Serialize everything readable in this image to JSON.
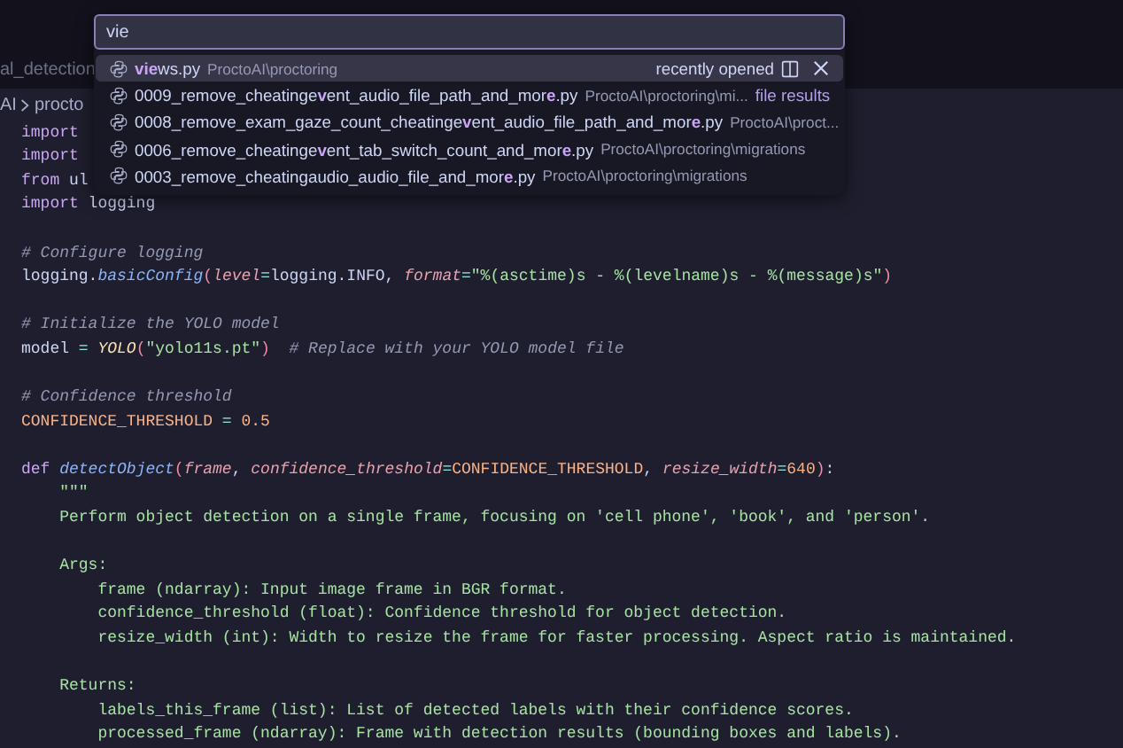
{
  "tab": {
    "label": "al_detection"
  },
  "breadcrumb": [
    "AI",
    "procto"
  ],
  "quick_open": {
    "query": "vie",
    "items": [
      {
        "name": "**vie**ws.py",
        "path": "ProctoAI\\proctoring",
        "section": "recently opened",
        "selected": true
      },
      {
        "name": "0009_remove_cheatinge**v**ent_audio_file_path_and_mor**e**.py",
        "path": "ProctoAI\\proctoring\\mi...",
        "section": "file results",
        "selected": false
      },
      {
        "name": "0008_remove_exam_gaze_count_cheatinge**v**ent_audio_file_path_and_mor**e**.py",
        "path": "ProctoAI\\proct...",
        "selected": false
      },
      {
        "name": "0006_remove_cheatinge**v**ent_tab_switch_count_and_mor**e**.py",
        "path": "ProctoAI\\proctoring\\migrations",
        "selected": false
      },
      {
        "name": "0003_remove_cheatingaudio_audio_file_and_mor**e**.py",
        "path": "ProctoAI\\proctoring\\migrations",
        "selected": false
      }
    ]
  },
  "code_blocks": [
    [
      [
        {
          "kind": "kw",
          "text": "import"
        }
      ],
      [
        {
          "kind": "kw",
          "text": "import"
        }
      ],
      [
        {
          "kind": "kw",
          "text": "from"
        },
        {
          "kind": "txt",
          "text": " ul"
        }
      ],
      [
        {
          "kind": "kw",
          "text": "import"
        },
        {
          "kind": "txt",
          "text": " logging"
        }
      ]
    ],
    [
      [
        {
          "kind": "cmt",
          "text": "# Configure logging"
        }
      ],
      [
        {
          "kind": "txt",
          "text": "logging."
        },
        {
          "kind": "fn",
          "text": "basicConfig"
        },
        {
          "kind": "par",
          "text": "("
        },
        {
          "kind": "arg",
          "text": "level"
        },
        {
          "kind": "op",
          "text": "="
        },
        {
          "kind": "txt",
          "text": "logging.INFO, "
        },
        {
          "kind": "arg",
          "text": "format"
        },
        {
          "kind": "op",
          "text": "="
        },
        {
          "kind": "str",
          "text": "\"%(asctime)s - %(levelname)s - %(message)s\""
        },
        {
          "kind": "par",
          "text": ")"
        }
      ]
    ],
    [
      [
        {
          "kind": "cmt",
          "text": "# Initialize the YOLO model"
        }
      ],
      [
        {
          "kind": "txt",
          "text": "model "
        },
        {
          "kind": "op",
          "text": "= "
        },
        {
          "kind": "cls",
          "text": "YOLO"
        },
        {
          "kind": "par",
          "text": "("
        },
        {
          "kind": "str",
          "text": "\"yolo11s.pt\""
        },
        {
          "kind": "par",
          "text": ")  "
        },
        {
          "kind": "cmt",
          "text": "# Replace with your YOLO model file"
        }
      ]
    ],
    [
      [
        {
          "kind": "cmt",
          "text": "# Confidence threshold"
        }
      ],
      [
        {
          "kind": "num",
          "text": "CONFIDENCE_THRESHOLD"
        },
        {
          "kind": "op",
          "text": " = "
        },
        {
          "kind": "num",
          "text": "0.5"
        }
      ]
    ],
    [
      [
        {
          "kind": "kw",
          "text": "def "
        },
        {
          "kind": "fn",
          "text": "detectObject"
        },
        {
          "kind": "par",
          "text": "("
        },
        {
          "kind": "arg",
          "text": "frame"
        },
        {
          "kind": "txt",
          "text": ", "
        },
        {
          "kind": "arg",
          "text": "confidence_threshold"
        },
        {
          "kind": "op",
          "text": "="
        },
        {
          "kind": "num",
          "text": "CONFIDENCE_THRESHOLD"
        },
        {
          "kind": "txt",
          "text": ", "
        },
        {
          "kind": "arg",
          "text": "resize_width"
        },
        {
          "kind": "op",
          "text": "="
        },
        {
          "kind": "num",
          "text": "640"
        },
        {
          "kind": "par",
          "text": ")"
        },
        {
          "kind": "txt",
          "text": ":"
        }
      ],
      [
        {
          "kind": "str",
          "text": "    \"\"\""
        }
      ],
      [
        {
          "kind": "str",
          "text": "    Perform object detection on a single frame, focusing on 'cell phone', 'book', and 'person'."
        }
      ]
    ],
    [
      [
        {
          "kind": "str",
          "text": "    Args:"
        }
      ],
      [
        {
          "kind": "str",
          "text": "        frame (ndarray): Input image frame in BGR format."
        }
      ],
      [
        {
          "kind": "str",
          "text": "        confidence_threshold (float): Confidence threshold for object detection."
        }
      ],
      [
        {
          "kind": "str",
          "text": "        resize_width (int): Width to resize the frame for faster processing. Aspect ratio is maintained."
        }
      ]
    ],
    [
      [
        {
          "kind": "str",
          "text": "    Returns:"
        }
      ],
      [
        {
          "kind": "str",
          "text": "        labels_this_frame (list): List of detected labels with their confidence scores."
        }
      ],
      [
        {
          "kind": "str",
          "text": "        processed_frame (ndarray): Frame with detection results (bounding boxes and labels)."
        }
      ]
    ]
  ]
}
